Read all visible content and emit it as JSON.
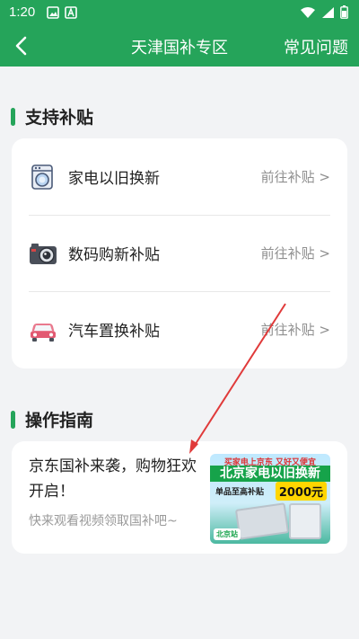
{
  "status_bar": {
    "time": "1:20"
  },
  "header": {
    "title": "天津国补专区",
    "faq": "常见问题",
    "back_icon": "back-arrow-icon"
  },
  "colors": {
    "brand_green": "#25a45a",
    "background": "#f2f3f5",
    "annotation_arrow": "#e03a3a"
  },
  "support": {
    "title": "支持补贴",
    "items": [
      {
        "label": "家电以旧换新",
        "action": "前往补贴 >",
        "icon": "washing-machine-icon"
      },
      {
        "label": "数码购新补贴",
        "action": "前往补贴 >",
        "icon": "camera-icon"
      },
      {
        "label": "汽车置换补贴",
        "action": "前往补贴 >",
        "icon": "car-icon"
      }
    ]
  },
  "guide": {
    "title": "操作指南",
    "card": {
      "headline": "京东国补来袭，购物狂欢开启！",
      "subtitle": "快来观看视频领取国补吧~",
      "thumb": {
        "top_line": "买家电上京东 又好又便宜",
        "banner": "北京家电以旧换新",
        "promo": "单品至高补贴",
        "amount": "2000元",
        "badge": "北京站"
      }
    }
  }
}
